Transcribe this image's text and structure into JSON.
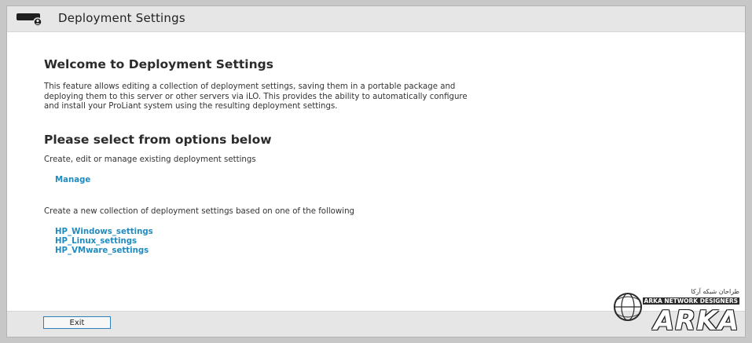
{
  "window": {
    "title": "Deployment Settings",
    "title_icon": "server-user-icon"
  },
  "main": {
    "heading": "Welcome to Deployment Settings",
    "description": "This feature allows editing a collection of deployment settings, saving them in a portable package and deploying them to this server or other servers via iLO. This provides the ability to automatically configure and install your ProLiant system using the resulting deployment settings.",
    "options_heading": "Please select from options below",
    "manage_prompt": "Create, edit or manage existing deployment settings",
    "manage_link": "Manage",
    "create_prompt": "Create a new collection of deployment settings based on one of the following",
    "templates": [
      "HP_Windows_settings",
      "HP_Linux_settings",
      "HP_VMware_settings"
    ]
  },
  "footer": {
    "exit_label": "Exit"
  },
  "watermark": {
    "top_text": "طراحان شبکه آرکا",
    "tag": "ARKA NETWORK DESIGNERS",
    "word": "ARKA"
  },
  "colors": {
    "link": "#1f8bbf",
    "bar": "#e6e6e6",
    "button_border": "#2f7fb8"
  }
}
